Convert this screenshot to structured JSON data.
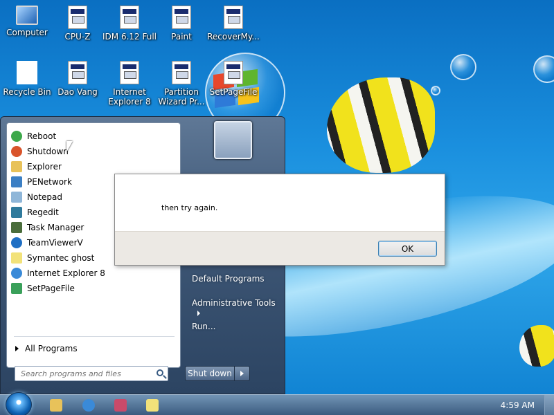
{
  "desktop": {
    "icons": [
      {
        "label": "Computer",
        "type": "computer"
      },
      {
        "label": "CPU-Z",
        "type": "doc"
      },
      {
        "label": "IDM 6.12 Full",
        "type": "doc"
      },
      {
        "label": "Paint",
        "type": "doc"
      },
      {
        "label": "RecoverMy...",
        "type": "doc"
      },
      {
        "label": "Recycle Bin",
        "type": "bin"
      },
      {
        "label": "Dao Vang",
        "type": "doc"
      },
      {
        "label": "Internet Explorer 8",
        "type": "doc"
      },
      {
        "label": "Partition Wizard Pr...",
        "type": "doc"
      },
      {
        "label": "SetPageFile",
        "type": "doc"
      }
    ]
  },
  "start_menu": {
    "programs": [
      {
        "label": "Reboot",
        "icon": "reboot-icon",
        "color": "#3ca84a"
      },
      {
        "label": "Shutdown",
        "icon": "power-icon",
        "color": "#d9542b"
      },
      {
        "label": "Explorer",
        "icon": "folder-icon",
        "color": "#e8c25a"
      },
      {
        "label": "PENetwork",
        "icon": "network-icon",
        "color": "#3b7fc4"
      },
      {
        "label": "Notepad",
        "icon": "notepad-icon",
        "color": "#8fb6d8"
      },
      {
        "label": "Regedit",
        "icon": "registry-icon",
        "color": "#2f7a9c"
      },
      {
        "label": "Task Manager",
        "icon": "task-manager-icon",
        "color": "#4a6d3b"
      },
      {
        "label": "TeamViewerV",
        "icon": "teamviewer-icon",
        "color": "#1f6fc4"
      },
      {
        "label": "Symantec ghost",
        "icon": "ghost-icon",
        "color": "#f2e27a"
      },
      {
        "label": "Internet Explorer 8",
        "icon": "ie-icon",
        "color": "#3a8ad8"
      },
      {
        "label": "SetPageFile",
        "icon": "setpagefile-icon",
        "color": "#3aa05a"
      }
    ],
    "all_programs": "All Programs",
    "search_placeholder": "Search programs and files",
    "right_items": [
      {
        "label": "Default Programs"
      },
      {
        "label": "Administrative Tools"
      },
      {
        "label": "Run..."
      }
    ],
    "shutdown_label": "Shut down"
  },
  "dialog": {
    "message": "then try again.",
    "ok_label": "OK"
  },
  "taskbar": {
    "clock": "4:59 AM",
    "pinned": [
      {
        "icon": "explorer-folder-icon",
        "color": "#e8c25a"
      },
      {
        "icon": "internet-explorer-icon",
        "color": "#3a8ad8"
      },
      {
        "icon": "network-tool-icon",
        "color": "#c94a6a"
      },
      {
        "icon": "symantec-ghost-icon",
        "color": "#f2e27a"
      }
    ]
  }
}
